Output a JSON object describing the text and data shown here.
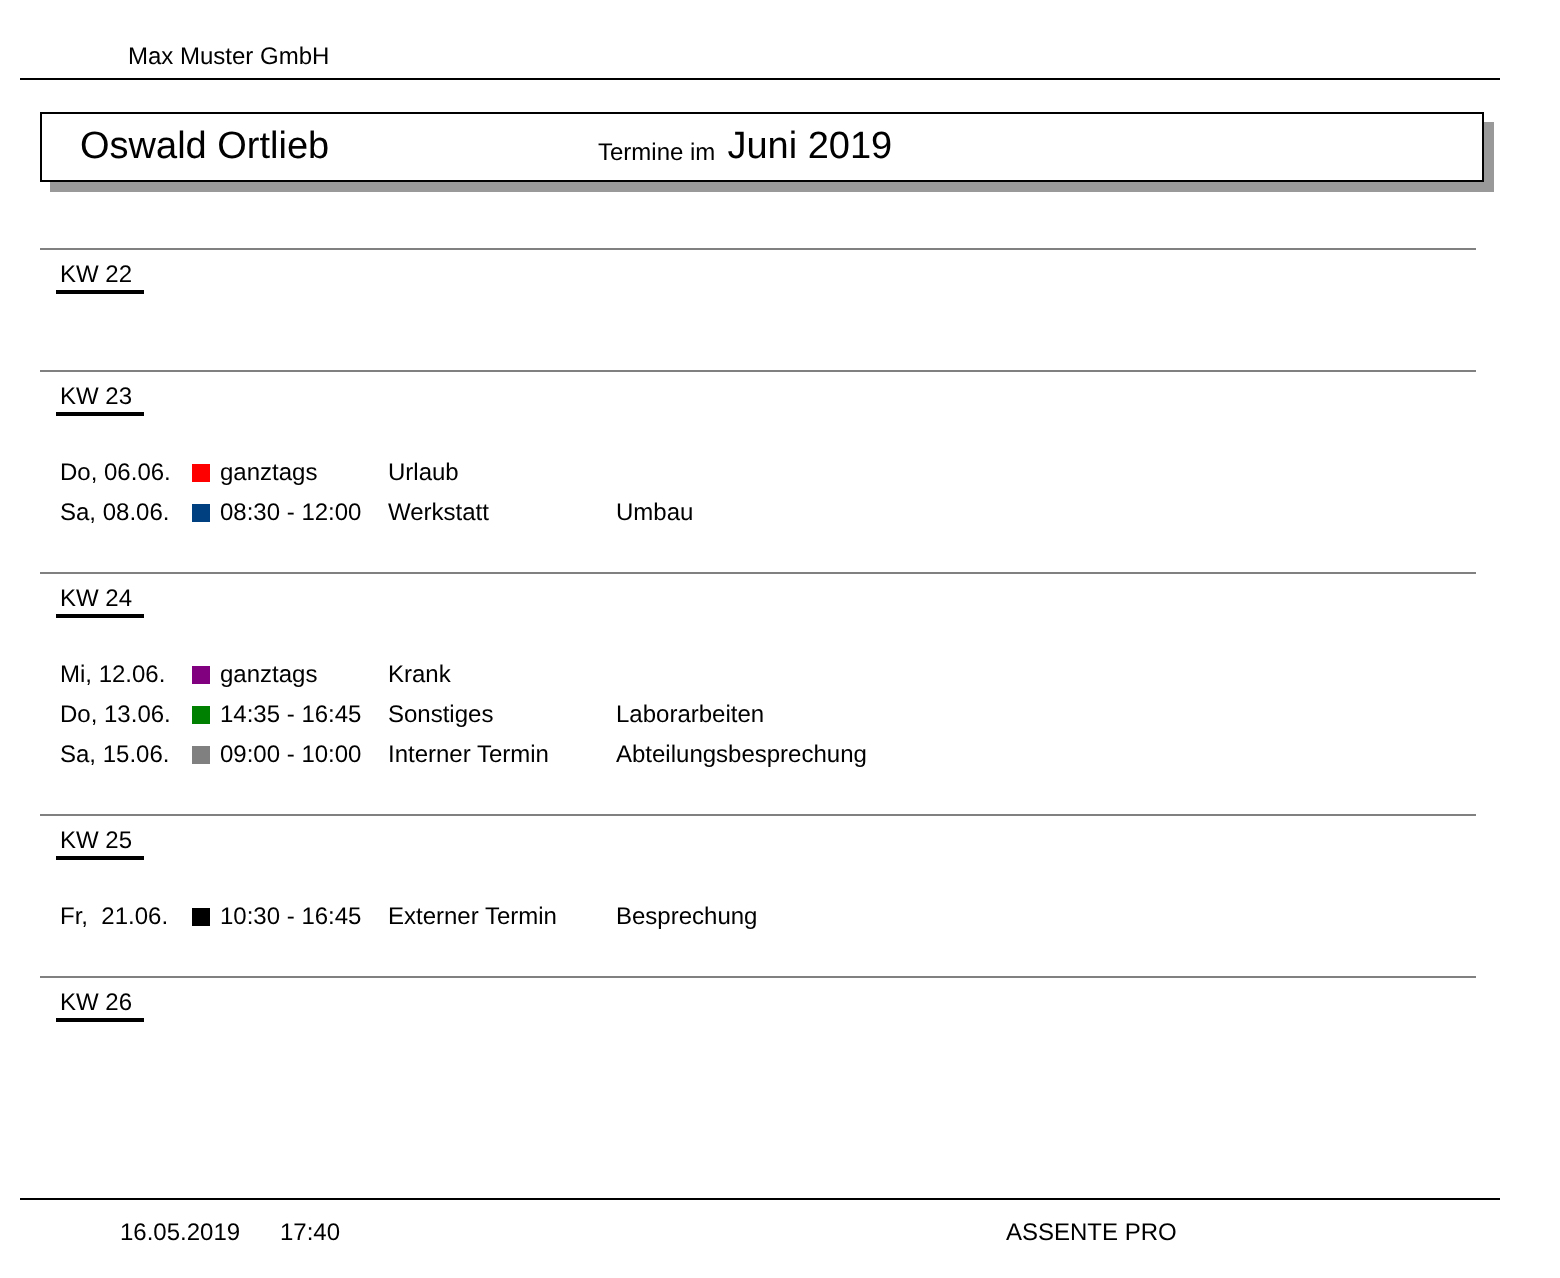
{
  "company": "Max Muster GmbH",
  "header": {
    "person": "Oswald Ortlieb",
    "caption": "Termine im",
    "period": "Juni 2019"
  },
  "weeks": [
    {
      "label": "KW 22"
    },
    {
      "label": "KW 23",
      "entries": [
        {
          "date": "Do, 06.06.",
          "color": "#ff0000",
          "time": "ganztags",
          "type": "Urlaub"
        },
        {
          "date": "Sa, 08.06.",
          "color": "#004080",
          "time": "08:30 - 12:00",
          "type": "Werkstatt",
          "note": "Umbau"
        }
      ]
    },
    {
      "label": "KW 24",
      "entries": [
        {
          "date": "Mi, 12.06.",
          "color": "#800080",
          "time": "ganztags",
          "type": "Krank"
        },
        {
          "date": "Do, 13.06.",
          "color": "#008000",
          "time": "14:35 - 16:45",
          "type": "Sonstiges",
          "note": "Laborarbeiten"
        },
        {
          "date": "Sa, 15.06.",
          "color": "#808080",
          "time": "09:00 - 10:00",
          "type": "Interner Termin",
          "note": "Abteilungsbesprechung"
        }
      ]
    },
    {
      "label": "KW 25",
      "entries": [
        {
          "date": "Fr,  21.06.",
          "color": "#000000",
          "time": "10:30 - 16:45",
          "type": "Externer Termin",
          "note": "Besprechung"
        }
      ]
    },
    {
      "label": "KW 26"
    }
  ],
  "footer": {
    "date": "16.05.2019",
    "time": "17:40",
    "product": "ASSENTE PRO"
  }
}
